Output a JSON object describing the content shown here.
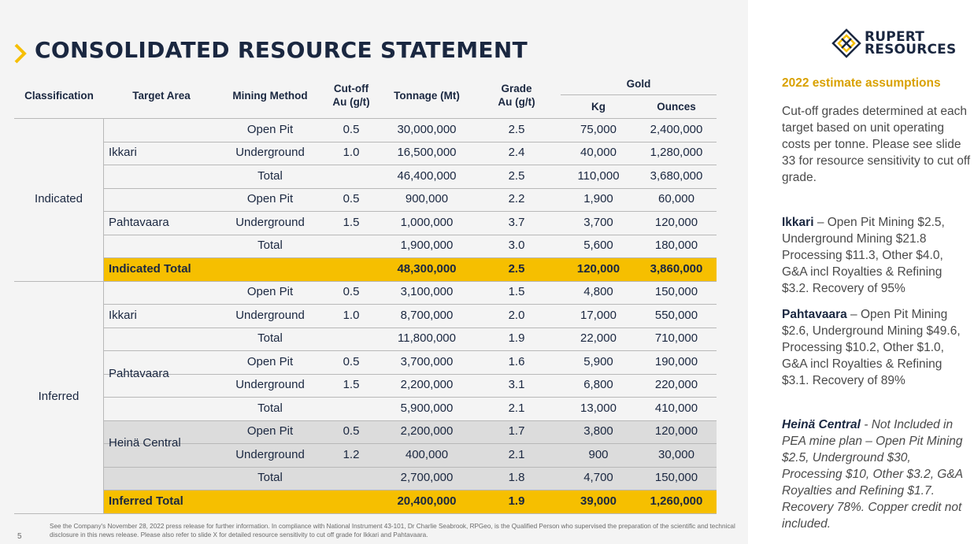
{
  "title": "CONSOLIDATED RESOURCE STATEMENT",
  "headers": {
    "classification": "Classification",
    "target_area": "Target Area",
    "mining_method": "Mining Method",
    "cutoff": "Cut-off\nAu (g/t)",
    "tonnage": "Tonnage (Mt)",
    "grade": "Grade\nAu (g/t)",
    "gold": "Gold",
    "kg": "Kg",
    "ounces": "Ounces"
  },
  "classes": [
    "Indicated",
    "Inferred"
  ],
  "areas": {
    "ind_ikkari": "Ikkari",
    "ind_pahtavaara": "Pahtavaara",
    "inf_ikkari": "Ikkari",
    "inf_pahtavaara": "Pahtavaara",
    "inf_heina": "Heinä Central"
  },
  "rows": [
    {
      "method": "Open Pit",
      "cutoff": "0.5",
      "tonnage": "30,000,000",
      "grade": "2.5",
      "kg": "75,000",
      "oz": "2,400,000"
    },
    {
      "method": "Underground",
      "cutoff": "1.0",
      "tonnage": "16,500,000",
      "grade": "2.4",
      "kg": "40,000",
      "oz": "1,280,000"
    },
    {
      "method": "Total",
      "cutoff": "",
      "tonnage": "46,400,000",
      "grade": "2.5",
      "kg": "110,000",
      "oz": "3,680,000"
    },
    {
      "method": "Open Pit",
      "cutoff": "0.5",
      "tonnage": "900,000",
      "grade": "2.2",
      "kg": "1,900",
      "oz": "60,000"
    },
    {
      "method": "Underground",
      "cutoff": "1.5",
      "tonnage": "1,000,000",
      "grade": "3.7",
      "kg": "3,700",
      "oz": "120,000"
    },
    {
      "method": "Total",
      "cutoff": "",
      "tonnage": "1,900,000",
      "grade": "3.0",
      "kg": "5,600",
      "oz": "180,000"
    },
    {
      "label": "Indicated Total",
      "method": "",
      "cutoff": "",
      "tonnage": "48,300,000",
      "grade": "2.5",
      "kg": "120,000",
      "oz": "3,860,000"
    },
    {
      "method": "Open Pit",
      "cutoff": "0.5",
      "tonnage": "3,100,000",
      "grade": "1.5",
      "kg": "4,800",
      "oz": "150,000"
    },
    {
      "method": "Underground",
      "cutoff": "1.0",
      "tonnage": "8,700,000",
      "grade": "2.0",
      "kg": "17,000",
      "oz": "550,000"
    },
    {
      "method": "Total",
      "cutoff": "",
      "tonnage": "11,800,000",
      "grade": "1.9",
      "kg": "22,000",
      "oz": "710,000"
    },
    {
      "method": "Open Pit",
      "cutoff": "0.5",
      "tonnage": "3,700,000",
      "grade": "1.6",
      "kg": "5,900",
      "oz": "190,000"
    },
    {
      "method": "Underground",
      "cutoff": "1.5",
      "tonnage": "2,200,000",
      "grade": "3.1",
      "kg": "6,800",
      "oz": "220,000"
    },
    {
      "method": "Total",
      "cutoff": "",
      "tonnage": "5,900,000",
      "grade": "2.1",
      "kg": "13,000",
      "oz": "410,000"
    },
    {
      "method": "Open Pit",
      "cutoff": "0.5",
      "tonnage": "2,200,000",
      "grade": "1.7",
      "kg": "3,800",
      "oz": "120,000"
    },
    {
      "method": "Underground",
      "cutoff": "1.2",
      "tonnage": "400,000",
      "grade": "2.1",
      "kg": "900",
      "oz": "30,000"
    },
    {
      "method": "Total",
      "cutoff": "",
      "tonnage": "2,700,000",
      "grade": "1.8",
      "kg": "4,700",
      "oz": "150,000"
    },
    {
      "label": "Inferred Total",
      "method": "",
      "cutoff": "",
      "tonnage": "20,400,000",
      "grade": "1.9",
      "kg": "39,000",
      "oz": "1,260,000"
    }
  ],
  "footnote": "See the Company's November 28, 2022 press release for further information. In compliance with National Instrument 43-101, Dr Charlie Seabrook, RPGeo, is the Qualified Person who supervised the preparation of the scientific and technical disclosure in this news release.  Please also refer to slide X for detailed resource sensitivity to cut off grade for Ikkari and Pahtavaara.",
  "page_number": "5",
  "logo": {
    "line1": "RUPERT",
    "line2": "RESOURCES"
  },
  "side": {
    "heading": "2022 estimate assumptions",
    "p1": "Cut-off grades determined at each target based on unit operating costs per tonne. Please see slide 33 for resource sensitivity to cut off grade.",
    "p2_key": "Ikkari",
    "p2": " – Open Pit Mining $2.5, Underground Mining $21.8 Processing $11.3, Other $4.0, G&A incl Royalties & Refining $3.2. Recovery of 95%",
    "p3_key": "Pahtavaara",
    "p3": " – Open Pit Mining $2.6, Underground Mining $49.6, Processing $10.2, Other $1.0, G&A incl Royalties & Refining $3.1. Recovery of 89%",
    "p4_key": "Heinä Central",
    "p4": " - Not Included in PEA mine plan – Open Pit Mining $2.5, Underground $30, Processing $10, Other $3.2, G&A Royalties and Refining $1.7. Recovery 78%. Copper credit not included."
  },
  "colors": {
    "accent": "#f6bf00",
    "heading_gold": "#d9a100",
    "navy": "#1a2740",
    "shade": "#dcdcdc"
  }
}
